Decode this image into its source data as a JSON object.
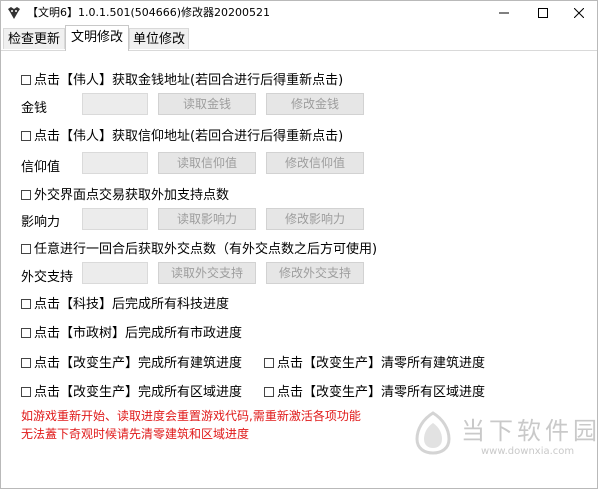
{
  "window": {
    "title": "【文明6】1.0.1.501(504666)修改器20200521",
    "controls": {
      "minimize": "—",
      "maximize": "☐",
      "close": "✕"
    }
  },
  "tabs": [
    {
      "label": "检查更新"
    },
    {
      "label": "文明修改"
    },
    {
      "label": "单位修改"
    }
  ],
  "sections": [
    {
      "checkbox": "点击【伟人】获取金钱地址(若回合进行后得重新点击)",
      "field_label": "金钱",
      "value": "",
      "read_button": "读取金钱",
      "modify_button": "修改金钱"
    },
    {
      "checkbox": "点击【伟人】获取信仰地址(若回合进行后得重新点击)",
      "field_label": "信仰值",
      "value": "",
      "read_button": "读取信仰值",
      "modify_button": "修改信仰值"
    },
    {
      "checkbox": "外交界面点交易获取外加支持点数",
      "field_label": "影响力",
      "value": "",
      "read_button": "读取影响力",
      "modify_button": "修改影响力"
    },
    {
      "checkbox": "任意进行一回合后获取外交点数（有外交点数之后方可使用)",
      "field_label": "外交支持",
      "value": "",
      "read_button": "读取外交支持",
      "modify_button": "修改外交支持"
    }
  ],
  "options": {
    "tech": "点击【科技】后完成所有科技进度",
    "civic": "点击【市政树】后完成所有市政进度",
    "build_complete": "点击【改变生产】完成所有建筑进度",
    "build_clear": "点击【改变生产】清零所有建筑进度",
    "district_complete": "点击【改变生产】完成所有区域进度",
    "district_clear": "点击【改变生产】清零所有区域进度"
  },
  "warning": {
    "line1": "如游戏重新开始、读取进度会重置游戏代码,需重新激活各项功能",
    "line2": "无法蓋下奇观时候请先清零建筑和区域进度"
  },
  "watermark": {
    "brand": "当下软件园",
    "url": "www.downxia.com"
  }
}
